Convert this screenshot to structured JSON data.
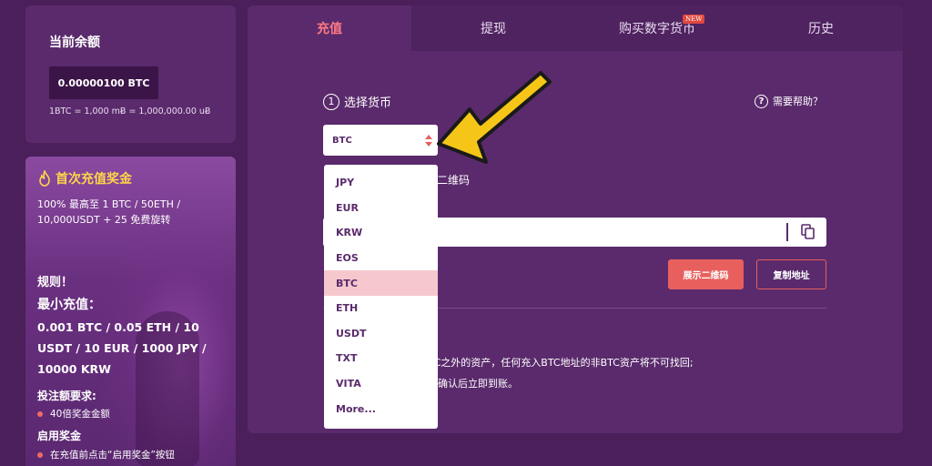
{
  "balance": {
    "title": "当前余额",
    "amount": "0.00000100 BTC",
    "rate": "1BTC = 1,000 mɃ = 1,000,000.00 uɃ"
  },
  "bonus": {
    "icon": "fire-icon",
    "title": "首次充值奖金",
    "desc": "100% 最高至 1 BTC / 50ETH / 10,000USDT + 25 免费旋转",
    "rules_title": "规则！",
    "min_title": "最小充值：",
    "min_values": "0.001 BTC / 0.05 ETH / 10 USDT / 10 EUR / 1000 JPY / 10000 KRW",
    "req_title": "投注额要求:",
    "req_item": "40倍奖金金额",
    "enable_title": "启用奖金",
    "enable_item": "在充值前点击“启用奖金”按钮"
  },
  "tabs": [
    {
      "label": "充值",
      "active": true
    },
    {
      "label": "提现"
    },
    {
      "label": "购买数字货币",
      "badge": "NEW"
    },
    {
      "label": "历史"
    }
  ],
  "deposit": {
    "step1_num": "1",
    "step1_label": "选择货币",
    "help": "需要帮助？",
    "selected_currency": "BTC",
    "step2_label": "二维码",
    "qr_button": "展示二维码",
    "copy_button": "复制地址",
    "notice1": "除BTC之外的资产，任何充入BTC地址的非BTC资产将不可找回;",
    "notice2": "网1个确认后立即到账。"
  },
  "dropdown": {
    "options": [
      "JPY",
      "EUR",
      "KRW",
      "EOS",
      "BTC",
      "ETH",
      "USDT",
      "TXT",
      "VITA",
      "More..."
    ],
    "selected": "BTC"
  },
  "colors": {
    "accent": "#e8605e",
    "tab_active": "#ff7a85",
    "bonus_title": "#ffd54a",
    "arrow": "#f5c518"
  }
}
